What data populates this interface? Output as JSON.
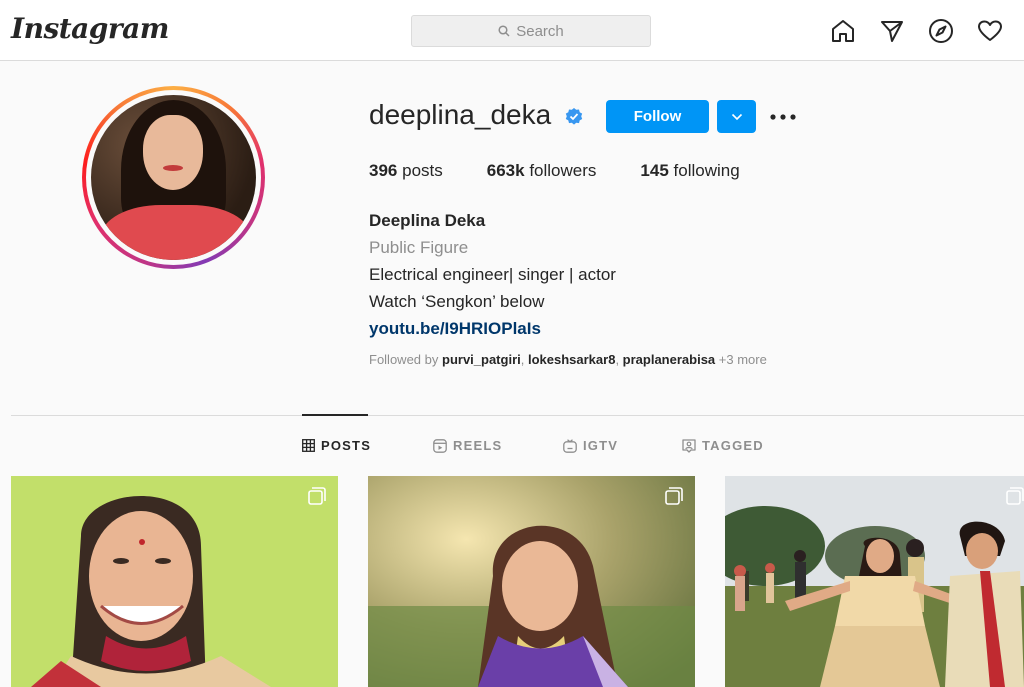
{
  "header": {
    "logo": "Instagram",
    "search_placeholder": "Search",
    "nav_icons": [
      "home-icon",
      "direct-send-icon",
      "explore-compass-icon",
      "activity-heart-icon"
    ]
  },
  "profile": {
    "username": "deeplina_deka",
    "verified": true,
    "follow_label": "Follow",
    "stats": {
      "posts_count": "396",
      "posts_label": "posts",
      "followers_count": "663k",
      "followers_label": "followers",
      "following_count": "145",
      "following_label": "following"
    },
    "full_name": "Deeplina Deka",
    "category": "Public Figure",
    "bio_line1": "Electrical engineer| singer | actor",
    "bio_line2": "Watch ‘Sengkon’ below",
    "link": "youtu.be/I9HRIOPlaIs",
    "followed_by_prefix": "Followed by",
    "followed_by_users": [
      "purvi_patgiri",
      "lokeshsarkar8",
      "praplanerabisa"
    ],
    "followed_by_more": "+3 more"
  },
  "tabs": [
    {
      "label": "POSTS",
      "icon": "grid-icon",
      "active": true
    },
    {
      "label": "REELS",
      "icon": "reels-icon",
      "active": false
    },
    {
      "label": "IGTV",
      "icon": "igtv-icon",
      "active": false
    },
    {
      "label": "TAGGED",
      "icon": "tagged-icon",
      "active": false
    }
  ],
  "colors": {
    "accent": "#0095f6",
    "link": "#00376b",
    "secondary_text": "#8e8e8e"
  }
}
